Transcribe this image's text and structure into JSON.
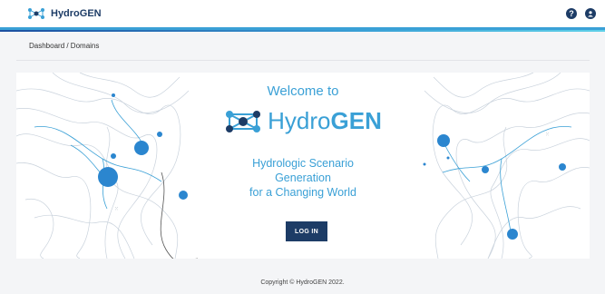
{
  "header": {
    "brand": "HydroGEN",
    "help_icon": "question-circle-icon",
    "account_icon": "user-circle-icon"
  },
  "breadcrumb": "Dashboard / Domains",
  "hero": {
    "welcome": "Welcome to",
    "logo_prefix": "Hydro",
    "logo_suffix": "GEN",
    "tagline_line1": "Hydrologic Scenario",
    "tagline_line2": "Generation",
    "tagline_line3": "for a Changing World",
    "login_label": "LOG IN"
  },
  "footer": "Copyright © HydroGEN 2022.",
  "colors": {
    "accent": "#3aa0d6",
    "navy": "#1d3c66"
  }
}
